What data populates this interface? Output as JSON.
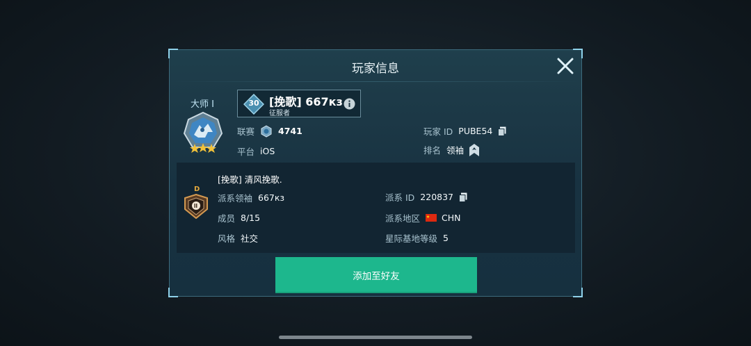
{
  "dialog": {
    "title": "玩家信息"
  },
  "player": {
    "rank_label": "大师 I",
    "level": "30",
    "name": "[挽歌] 667кз",
    "title": "征服者",
    "league_label": "联赛",
    "league_value": "4741",
    "platform_label": "平台",
    "platform_value": "iOS",
    "id_label": "玩家 ID",
    "id_value": "PUBE54",
    "ranking_label": "排名",
    "ranking_value": "领袖"
  },
  "clan": {
    "tier": "D",
    "name": "[挽歌]  清风挽歌.",
    "leader_label": "派系领袖",
    "leader_value": "667кз",
    "id_label": "派系 ID",
    "id_value": "220837",
    "members_label": "成员",
    "members_value": "8/15",
    "region_label": "派系地区",
    "region_value": "CHN",
    "style_label": "风格",
    "style_value": "社交",
    "base_level_label": "星际基地等级",
    "base_level_value": "5"
  },
  "actions": {
    "add_friend_label": "添加至好友"
  },
  "colors": {
    "accent_green": "#1db78d",
    "tier_gold": "#e5a93d",
    "panel_bg": "#122532"
  },
  "icons": {
    "close": "close-icon",
    "info": "info-icon",
    "copy": "copy-icon",
    "league": "league-icon",
    "rank": "rank-chevron-icon",
    "flag": "china-flag-icon"
  }
}
